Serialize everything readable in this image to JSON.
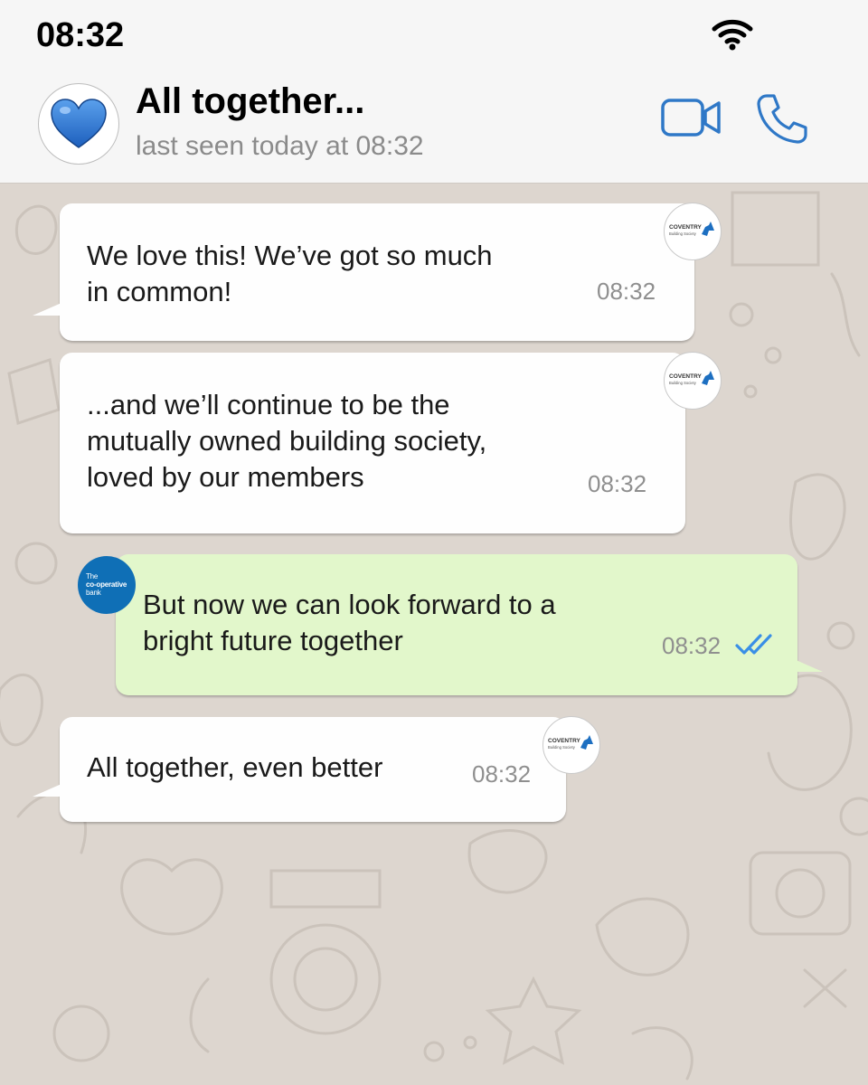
{
  "status": {
    "time": "08:32",
    "wifi_icon": "wifi-icon"
  },
  "header": {
    "avatar_icon": "blue-heart-icon",
    "title": "All together...",
    "subtitle": "last seen today at 08:32",
    "video_icon": "video-call-icon",
    "call_icon": "phone-icon",
    "accent": "#2f78c7"
  },
  "messages": [
    {
      "direction": "incoming",
      "sender": "Coventry Building Society",
      "text": "We love this! We’ve got so much\nin common!",
      "time": "08:32"
    },
    {
      "direction": "incoming",
      "sender": "Coventry Building Society",
      "text": "...and we’ll continue to be the\nmutually owned building society,\nloved by our members",
      "time": "08:32"
    },
    {
      "direction": "outgoing",
      "sender": "The co-operative bank",
      "text": "But now we can look forward to a\nbright future together",
      "time": "08:32",
      "status_icon": "double-check-icon"
    },
    {
      "direction": "incoming",
      "sender": "Coventry Building Society",
      "text": "All together, even better",
      "time": "08:32"
    }
  ],
  "logos": {
    "coventry_line1": "COVENTRY",
    "coventry_line2": "Building Society",
    "coop_line1": "The",
    "coop_line2": "co-operative",
    "coop_line3": "bank"
  },
  "colors": {
    "incoming_bubble": "#fefefe",
    "outgoing_bubble": "#e2f7cb",
    "wallpaper": "#ddd6cf",
    "read_ticks": "#3a8fe6"
  }
}
